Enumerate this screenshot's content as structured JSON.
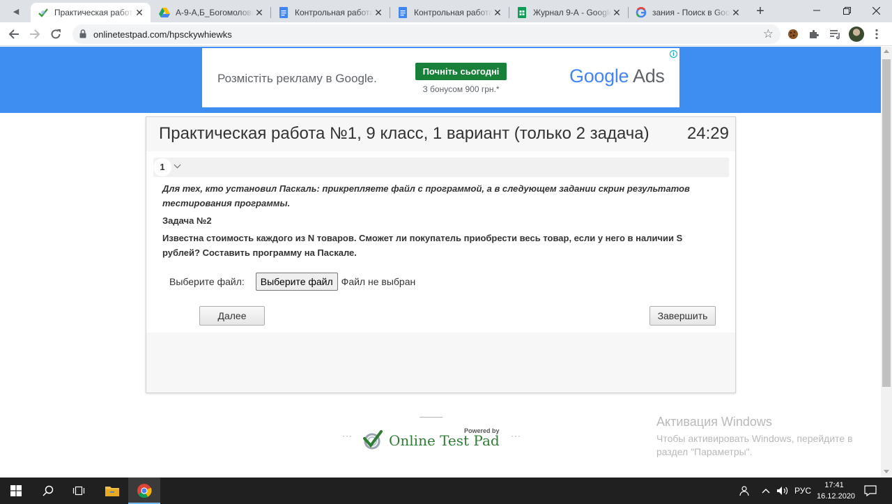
{
  "browser": {
    "tabs": [
      {
        "title": "Практическая работа",
        "active": true
      },
      {
        "title": "А-9-А,Б_Богомолова",
        "active": false
      },
      {
        "title": "Контрольная работа",
        "active": false
      },
      {
        "title": "Контрольная работа",
        "active": false
      },
      {
        "title": "Журнал 9-А - Google",
        "active": false
      },
      {
        "title": "зания - Поиск в Goo",
        "active": false
      }
    ],
    "url": "onlinetestpad.com/hpsckywhiewks"
  },
  "ad": {
    "text": "Розмістіть рекламу в Google.",
    "cta": "Почніть сьогодні",
    "bonus": "З бонусом 900 грн.*",
    "logo_google": "Google",
    "logo_ads": "Ads",
    "info": "i"
  },
  "test": {
    "title": "Практическая работа №1, 9 класс, 1 вариант (только 2 задача)",
    "timer": "24:29",
    "question_number": "1",
    "instruction": "Для тех, кто установил Паскаль: прикрепляете файл с программой, а в следующем задании скрин результатов тестирования программы.",
    "task_label": "Задача №2",
    "task_text": "Известна стоимость каждого из N товаров. Сможет ли покупатель приобрести весь товар, если у него в наличии S рублей? Составить программу на Паскале.",
    "file_label": "Выберите файл:",
    "file_button": "Выберите файл",
    "file_status": "Файл не выбран",
    "next_button": "Далее",
    "finish_button": "Завершить"
  },
  "footer": {
    "powered_by": "Powered by",
    "brand": "Online Test Pad",
    "dots": "···"
  },
  "windows_activation": {
    "title": "Активация Windows",
    "text": "Чтобы активировать Windows, перейдите в раздел \"Параметры\"."
  },
  "taskbar": {
    "language": "РУС",
    "time": "17:41",
    "date": "16.12.2020"
  },
  "colors": {
    "banner_blue": "#3d8ef0",
    "cta_green": "#188038",
    "brand_green": "#2e7d32",
    "taskbar": "#202020"
  }
}
